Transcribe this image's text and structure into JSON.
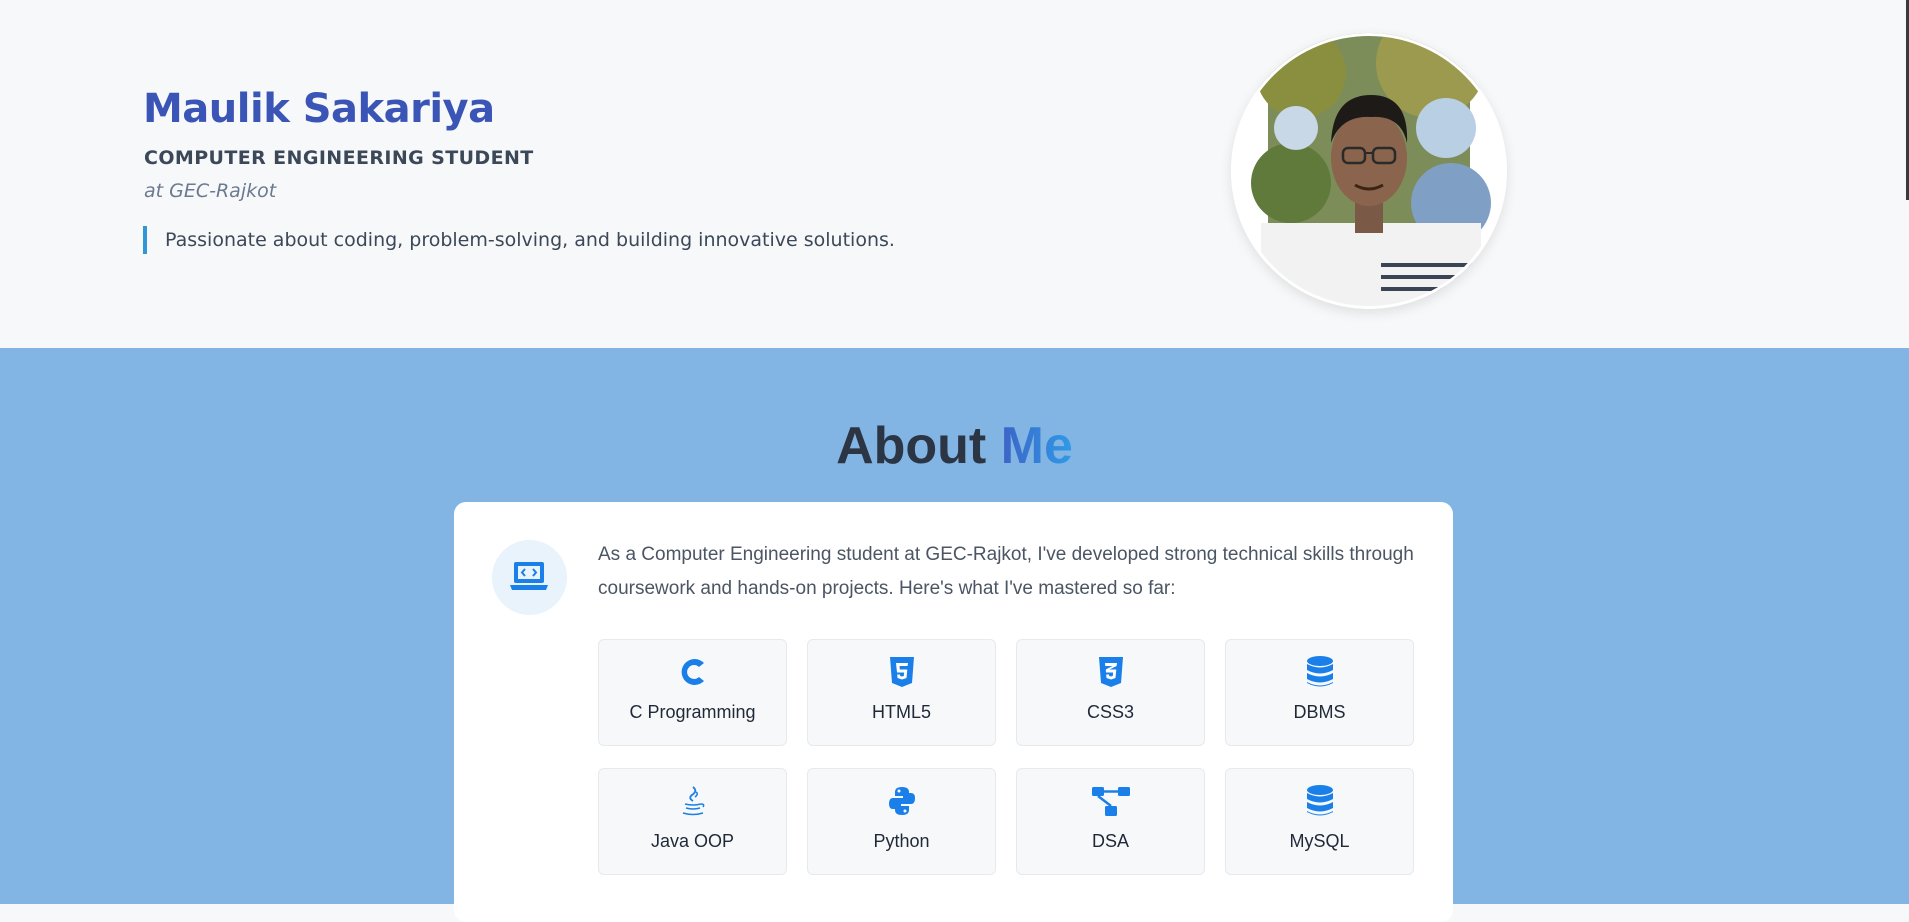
{
  "hero": {
    "name": "Maulik Sakariya",
    "role": "COMPUTER ENGINEERING STUDENT",
    "school": "at GEC-Rajkot",
    "tagline": "Passionate about coding, problem-solving, and building innovative solutions."
  },
  "about": {
    "title_main": "About ",
    "title_accent": "Me",
    "intro": "As a Computer Engineering student at GEC-Rajkot, I've developed strong technical skills through coursework and hands-on projects. Here's what I've mastered so far:",
    "skills": [
      {
        "label": "C Programming",
        "icon": "c-language-icon"
      },
      {
        "label": "HTML5",
        "icon": "html5-icon"
      },
      {
        "label": "CSS3",
        "icon": "css3-icon"
      },
      {
        "label": "DBMS",
        "icon": "database-icon"
      },
      {
        "label": "Java OOP",
        "icon": "java-icon"
      },
      {
        "label": "Python",
        "icon": "python-icon"
      },
      {
        "label": "DSA",
        "icon": "sitemap-icon"
      },
      {
        "label": "MySQL",
        "icon": "database-icon"
      }
    ]
  },
  "colors": {
    "name": "#3a55b6",
    "accent_bar": "#2f97d6",
    "about_bg": "#82b5e4",
    "icon_blue": "#1a7fe8"
  }
}
